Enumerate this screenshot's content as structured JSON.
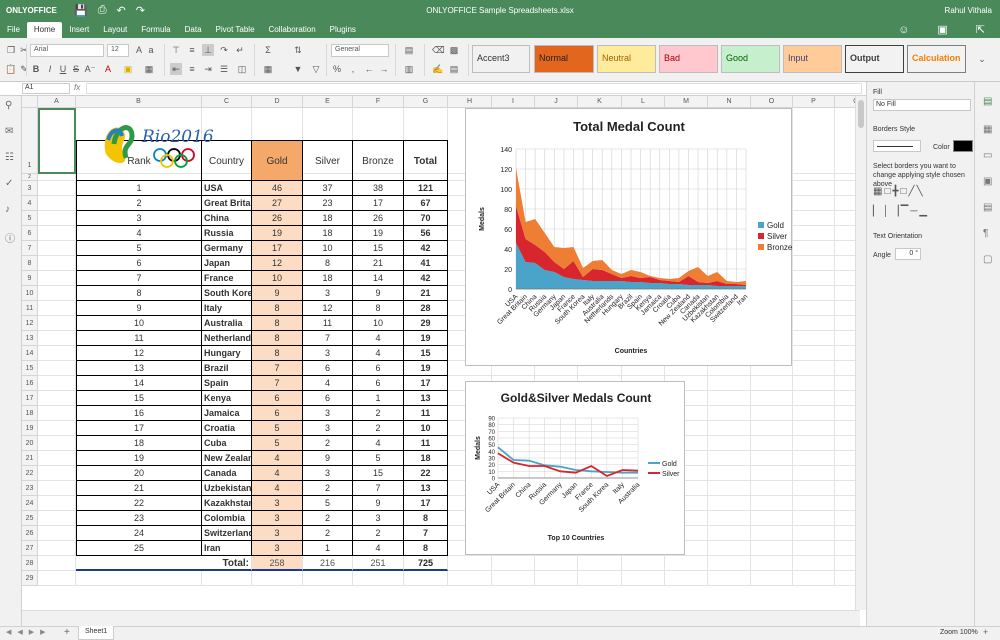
{
  "app": {
    "brand": "ONLYOFFICE",
    "doc_title": "ONLYOFFICE Sample Spreadsheets.xlsx",
    "user": "Rahul Vithala"
  },
  "menu": [
    "File",
    "Home",
    "Insert",
    "Layout",
    "Formula",
    "Data",
    "Pivot Table",
    "Collaboration",
    "Plugins"
  ],
  "toolbar": {
    "font": "Arial",
    "size": "12",
    "number_format": "General",
    "styles": [
      {
        "label": "Accent3",
        "bg": "#ffffff",
        "fg": "#333333"
      },
      {
        "label": "Normal",
        "bg": "#e3661f",
        "fg": "#222222"
      },
      {
        "label": "Neutral",
        "bg": "#ffeb9c",
        "fg": "#9c6500"
      },
      {
        "label": "Bad",
        "bg": "#ffc7ce",
        "fg": "#9c0006"
      },
      {
        "label": "Good",
        "bg": "#c6efce",
        "fg": "#006100"
      },
      {
        "label": "Input",
        "bg": "#ffcc99",
        "fg": "#3f3f76"
      },
      {
        "label": "Output",
        "bg": "#f2f2f2",
        "fg": "#3f3f3f"
      },
      {
        "label": "Calculation",
        "bg": "#f2f2f2",
        "fg": "#fa7d00"
      }
    ]
  },
  "namebox": "A1",
  "fx": "fx",
  "columns": [
    "A",
    "B",
    "C",
    "D",
    "E",
    "F",
    "G",
    "H",
    "I",
    "J",
    "K",
    "L",
    "M",
    "N",
    "O",
    "P",
    "Q",
    "R"
  ],
  "rows": [
    "1",
    "2",
    "3",
    "4",
    "5",
    "6",
    "7",
    "8",
    "9",
    "10",
    "11",
    "12",
    "13",
    "14",
    "15",
    "16",
    "17",
    "18",
    "19",
    "20",
    "21",
    "22",
    "23",
    "24",
    "25",
    "26",
    "27",
    "28",
    "29"
  ],
  "logo": {
    "text": "Rio2016"
  },
  "table": {
    "headers": [
      "Rank",
      "Country",
      "Gold",
      "Silver",
      "Bronze",
      "Total"
    ],
    "rows": [
      [
        "1",
        "USA",
        "46",
        "37",
        "38",
        "121"
      ],
      [
        "2",
        "Great Britain",
        "27",
        "23",
        "17",
        "67"
      ],
      [
        "3",
        "China",
        "26",
        "18",
        "26",
        "70"
      ],
      [
        "4",
        "Russia",
        "19",
        "18",
        "19",
        "56"
      ],
      [
        "5",
        "Germany",
        "17",
        "10",
        "15",
        "42"
      ],
      [
        "6",
        "Japan",
        "12",
        "8",
        "21",
        "41"
      ],
      [
        "7",
        "France",
        "10",
        "18",
        "14",
        "42"
      ],
      [
        "8",
        "South Korea",
        "9",
        "3",
        "9",
        "21"
      ],
      [
        "9",
        "Italy",
        "8",
        "12",
        "8",
        "28"
      ],
      [
        "10",
        "Australia",
        "8",
        "11",
        "10",
        "29"
      ],
      [
        "11",
        "Netherlands",
        "8",
        "7",
        "4",
        "19"
      ],
      [
        "12",
        "Hungary",
        "8",
        "3",
        "4",
        "15"
      ],
      [
        "13",
        "Brazil",
        "7",
        "6",
        "6",
        "19"
      ],
      [
        "14",
        "Spain",
        "7",
        "4",
        "6",
        "17"
      ],
      [
        "15",
        "Kenya",
        "6",
        "6",
        "1",
        "13"
      ],
      [
        "16",
        "Jamaica",
        "6",
        "3",
        "2",
        "11"
      ],
      [
        "17",
        "Croatia",
        "5",
        "3",
        "2",
        "10"
      ],
      [
        "18",
        "Cuba",
        "5",
        "2",
        "4",
        "11"
      ],
      [
        "19",
        "New Zealand",
        "4",
        "9",
        "5",
        "18"
      ],
      [
        "20",
        "Canada",
        "4",
        "3",
        "15",
        "22"
      ],
      [
        "21",
        "Uzbekistan",
        "4",
        "2",
        "7",
        "13"
      ],
      [
        "22",
        "Kazakhstan",
        "3",
        "5",
        "9",
        "17"
      ],
      [
        "23",
        "Colombia",
        "3",
        "2",
        "3",
        "8"
      ],
      [
        "24",
        "Switzerland",
        "3",
        "2",
        "2",
        "7"
      ],
      [
        "25",
        "Iran",
        "3",
        "1",
        "4",
        "8"
      ]
    ],
    "total_label": "Total:",
    "totals": [
      "258",
      "216",
      "251",
      "725"
    ]
  },
  "chart_data": [
    {
      "type": "area",
      "title": "Total Medal Count",
      "xlabel": "Countries",
      "ylabel": "Medals",
      "ylim": [
        0,
        140
      ],
      "yticks": [
        0,
        20,
        40,
        60,
        80,
        100,
        120,
        140
      ],
      "categories": [
        "USA",
        "Great Britain",
        "China",
        "Russia",
        "Germany",
        "Japan",
        "France",
        "South Korea",
        "Italy",
        "Australia",
        "Netherlands",
        "Hungary",
        "Brazil",
        "Spain",
        "Kenya",
        "Jamaica",
        "Croatia",
        "Cuba",
        "New Zealand",
        "Canada",
        "Uzbekistan",
        "Kazakhstan",
        "Colombia",
        "Switzerland",
        "Iran"
      ],
      "series": [
        {
          "name": "Gold",
          "color": "#4aa3c8",
          "values": [
            46,
            27,
            26,
            19,
            17,
            12,
            10,
            9,
            8,
            8,
            8,
            8,
            7,
            7,
            6,
            6,
            5,
            5,
            4,
            4,
            4,
            3,
            3,
            3,
            3
          ]
        },
        {
          "name": "Silver",
          "color": "#d7262e",
          "values": [
            37,
            23,
            18,
            18,
            10,
            8,
            18,
            3,
            12,
            11,
            7,
            3,
            6,
            4,
            6,
            3,
            3,
            2,
            9,
            3,
            2,
            5,
            2,
            2,
            1
          ]
        },
        {
          "name": "Bronze",
          "color": "#ee7e33",
          "values": [
            38,
            17,
            26,
            19,
            15,
            21,
            14,
            9,
            8,
            10,
            4,
            4,
            6,
            6,
            1,
            2,
            2,
            4,
            5,
            15,
            7,
            9,
            3,
            2,
            4
          ]
        }
      ],
      "legend": "right",
      "stacked": true,
      "grid": true
    },
    {
      "type": "line",
      "title": "Gold&Silver Medals Count",
      "xlabel": "Top 10 Countries",
      "ylabel": "Medals",
      "ylim": [
        0,
        90
      ],
      "yticks": [
        0,
        10,
        20,
        30,
        40,
        50,
        60,
        70,
        80,
        90
      ],
      "categories": [
        "USA",
        "Great Britain",
        "China",
        "Russia",
        "Germany",
        "Japan",
        "France",
        "South Korea",
        "Italy",
        "Australia"
      ],
      "series": [
        {
          "name": "Gold",
          "color": "#4aa3c8",
          "values": [
            46,
            27,
            26,
            19,
            17,
            12,
            10,
            9,
            8,
            8
          ]
        },
        {
          "name": "Silver",
          "color": "#d7262e",
          "values": [
            37,
            23,
            18,
            18,
            10,
            8,
            18,
            3,
            12,
            11
          ]
        }
      ],
      "legend": "right",
      "grid": true
    }
  ],
  "panel": {
    "fill_title": "Fill",
    "fill_value": "No Fill",
    "borders_title": "Borders Style",
    "color_label": "Color",
    "borders_hint": "Select borders you want to change applying style chosen above",
    "orient_title": "Text Orientation",
    "angle_label": "Angle",
    "angle_value": "0 °"
  },
  "sheet": {
    "tab": "Sheet1",
    "zoom": "Zoom 100%"
  }
}
